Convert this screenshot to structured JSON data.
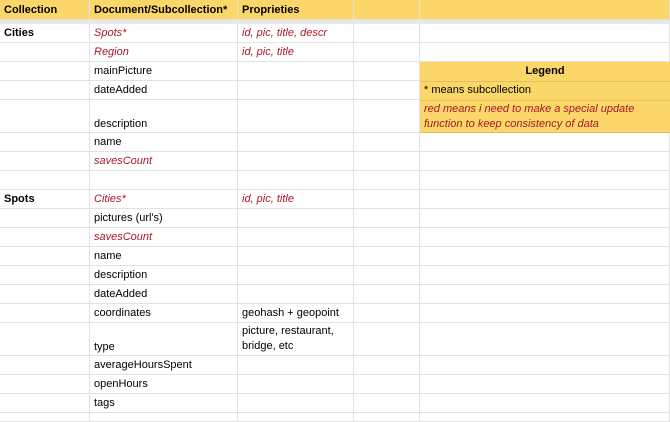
{
  "header": {
    "collection": "Collection",
    "document": "Document/Subcollection*",
    "proprieties": "Proprieties"
  },
  "rows": {
    "r1": {
      "collection": "Cities",
      "document": "Spots*",
      "prop": "id, pic, title, descr"
    },
    "r2": {
      "document": "Region",
      "prop": "id, pic, title"
    },
    "r3": {
      "document": "mainPicture"
    },
    "r4": {
      "document": "dateAdded"
    },
    "r5": {
      "document": "description"
    },
    "r6": {
      "document": "name"
    },
    "r7": {
      "document": "savesCount"
    },
    "r9": {
      "collection": "Spots",
      "document": "Cities*",
      "prop": "id, pic, title"
    },
    "r10": {
      "document": "pictures (url's)"
    },
    "r11": {
      "document": "savesCount"
    },
    "r12": {
      "document": "name"
    },
    "r13": {
      "document": "description"
    },
    "r14": {
      "document": "dateAdded"
    },
    "r15": {
      "document": "coordinates",
      "prop": "geohash + geopoint"
    },
    "r16": {
      "document": "type",
      "prop": "picture, restaurant, bridge, etc"
    },
    "r17": {
      "document": "averageHoursSpent"
    },
    "r18": {
      "document": "openHours"
    },
    "r19": {
      "document": "tags"
    }
  },
  "legend": {
    "title": "Legend",
    "line1": "* means subcollection",
    "line2": "red means i need to make a special update function to keep consistency of data"
  },
  "colors": {
    "header_bg": "#fbd669",
    "red_text": "#a8182a",
    "grid": "#e2e2e2"
  }
}
